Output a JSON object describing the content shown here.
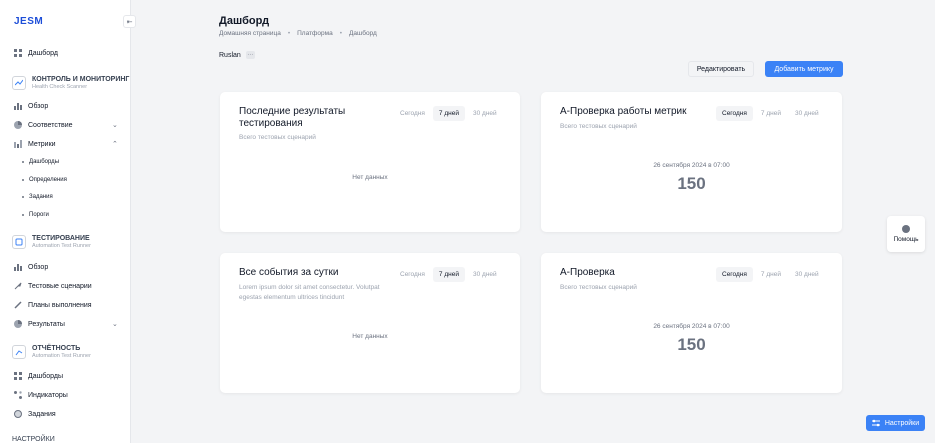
{
  "sidebar": {
    "logo": "JESM",
    "dashboard": "Дашборд",
    "section1": {
      "title": "КОНТРОЛЬ И МОНИТОРИНГ",
      "subtitle": "Health Check Scanner"
    },
    "overview1": "Обзор",
    "compliance": "Соответствие",
    "metrics": "Метрики",
    "metrics_sub": [
      "Дашборды",
      "Определения",
      "Задания",
      "Пороги"
    ],
    "section2": {
      "title": "ТЕСТИРОВАНИЕ",
      "subtitle": "Automation Test Runner"
    },
    "overview2": "Обзор",
    "test_scenarios": "Тестовые сценарии",
    "exec_plans": "Планы выполнения",
    "results": "Результаты",
    "section3": {
      "title": "ОТЧЁТНОСТЬ",
      "subtitle": "Automation Test Runner"
    },
    "dashboards": "Дашборды",
    "indicators": "Индикаторы",
    "tasks": "Задания",
    "settings": "НАСТРОЙКИ"
  },
  "header": {
    "title": "Дашборд",
    "breadcrumbs": [
      "Домашняя страница",
      "Платформа",
      "Дашборд"
    ],
    "user": "Ruslan",
    "more": "···"
  },
  "toolbar": {
    "edit": "Редактировать",
    "add": "Добавить метрику"
  },
  "periods": {
    "today": "Сегодня",
    "week": "7 дней",
    "month": "30 дней"
  },
  "cards": [
    {
      "title": "Последние результаты тестирования",
      "subtitle": "Всего тестовых сценарий",
      "empty": "Нет данных",
      "active": "week"
    },
    {
      "title": "А-Проверка работы метрик",
      "subtitle": "Всего тестовых сценарий",
      "timestamp": "26 сентября 2024 в 07:00",
      "value": "150",
      "active": "today"
    },
    {
      "title": "Все события за сутки",
      "subtitle": "Lorem ipsum dolor sit amet consectetur. Volutpat egestas elementum ultrices tincidunt",
      "empty": "Нет данных",
      "active": "week"
    },
    {
      "title": "А-Проверка",
      "subtitle": "Всего тестовых сценарий",
      "timestamp": "26 сентября 2024 в 07:00",
      "value": "150",
      "active": "today"
    }
  ],
  "help": "Помощь",
  "settings_button": "Настройки",
  "colors": {
    "accent": "#3b82f6",
    "brand": "#1d4ed8"
  }
}
